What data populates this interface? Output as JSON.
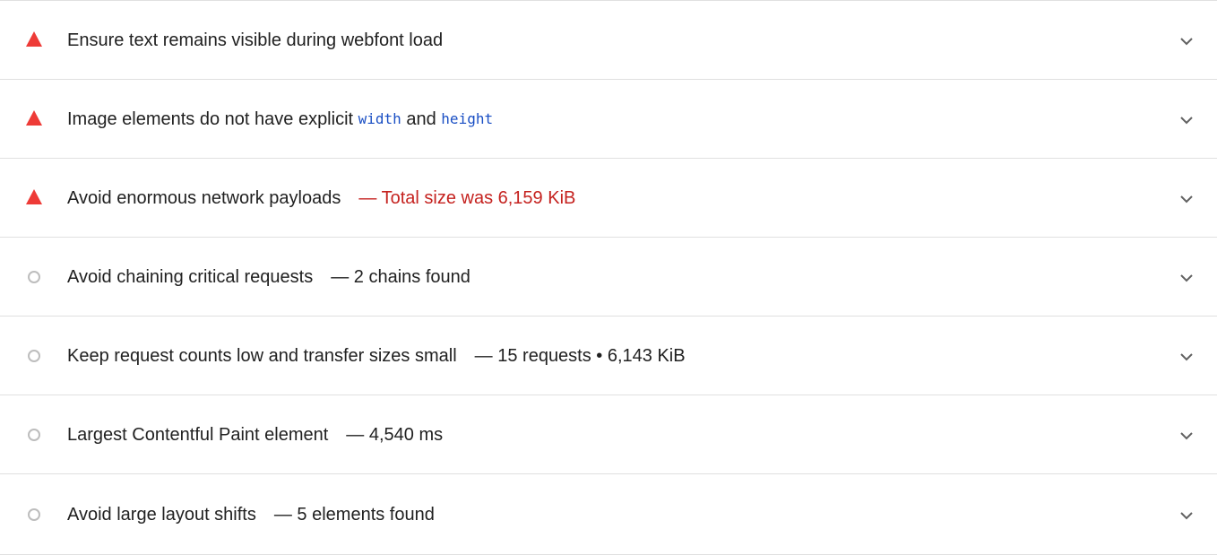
{
  "audits": [
    {
      "status": "fail",
      "status_icon": "red-triangle-icon",
      "title": "Ensure text remains visible during webfont load",
      "display_value": ""
    },
    {
      "status": "fail",
      "status_icon": "red-triangle-icon",
      "title_parts": {
        "pre": "Image elements do not have explicit ",
        "code1": "width",
        "mid": " and ",
        "code2": "height"
      },
      "display_value": ""
    },
    {
      "status": "fail",
      "status_icon": "red-triangle-icon",
      "title": "Avoid enormous network payloads",
      "display_value": "— Total size was 6,159 KiB"
    },
    {
      "status": "info",
      "status_icon": "grey-circle-icon",
      "title": "Avoid chaining critical requests",
      "display_value": "— 2 chains found"
    },
    {
      "status": "info",
      "status_icon": "grey-circle-icon",
      "title": "Keep request counts low and transfer sizes small",
      "display_value": "— 15 requests • 6,143 KiB"
    },
    {
      "status": "info",
      "status_icon": "grey-circle-icon",
      "title": "Largest Contentful Paint element",
      "display_value": "— 4,540 ms"
    },
    {
      "status": "info",
      "status_icon": "grey-circle-icon",
      "title": "Avoid large layout shifts",
      "display_value": "— 5 elements found"
    }
  ],
  "colors": {
    "fail": "#ee3b37",
    "fail_text": "#c5221f",
    "info": "#bdbdbd",
    "code": "#1a4fc4",
    "divider": "#e0e0e0"
  }
}
